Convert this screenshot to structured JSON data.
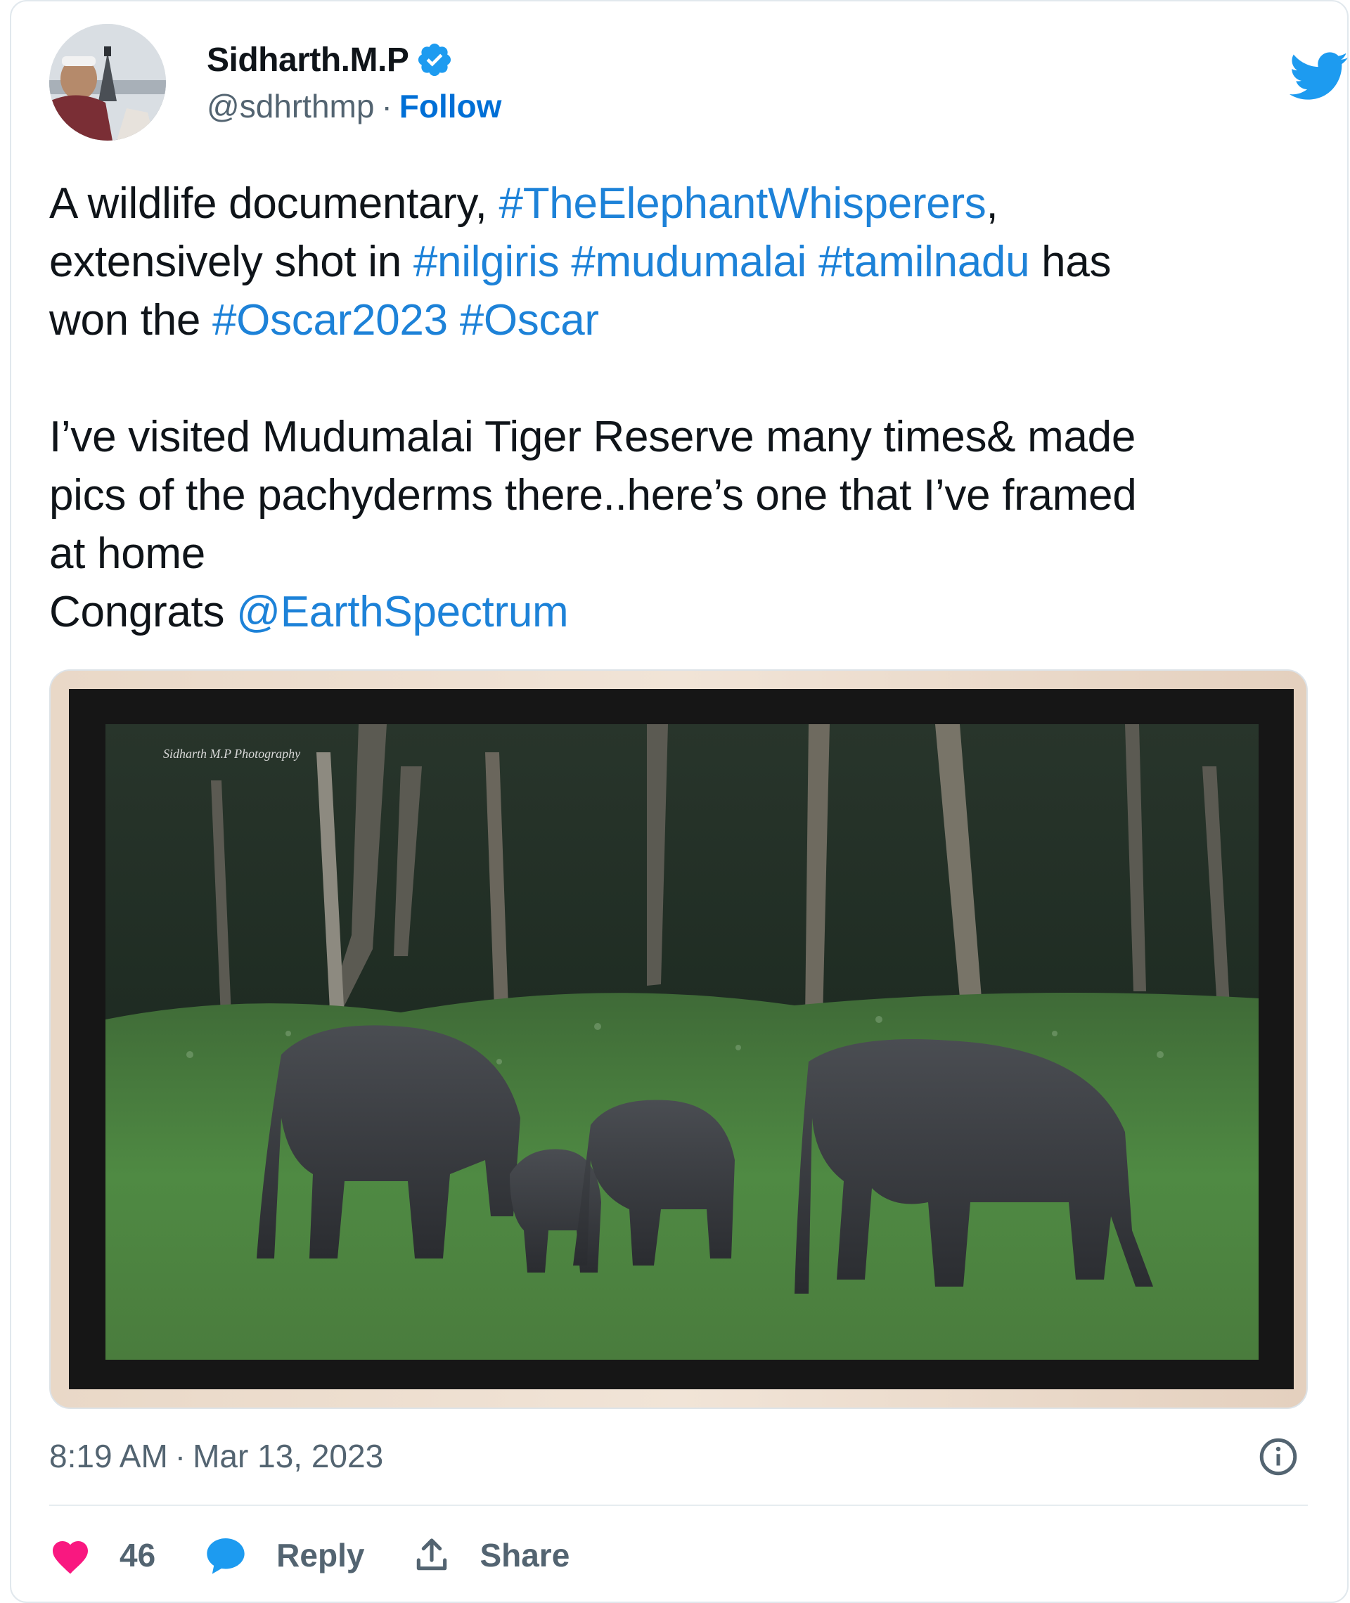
{
  "author": {
    "display_name": "Sidharth.M.P",
    "handle": "@sdhrthmp",
    "separator": "·",
    "follow_label": "Follow"
  },
  "tweet": {
    "line1_prefix": "A wildlife documentary, ",
    "tag_elephant": "#TheElephantWhisperers",
    "line1_suffix": ",",
    "line2_prefix": "extensively shot in ",
    "tag_nilgiris": "#nilgiris",
    "tag_mudumalai": "#mudumalai",
    "tag_tamilnadu": "#tamilnadu",
    "line2_suffix": " has",
    "line3_prefix": "won the ",
    "tag_oscar2023": "#Oscar2023",
    "tag_oscar": "#Oscar",
    "para2_line1": "I’ve visited Mudumalai Tiger Reserve many times& made",
    "para2_line2": "pics of the pachyderms there..here’s one that I’ve framed",
    "para2_line3": "at home",
    "congrats_prefix": "Congrats ",
    "mention": "@EarthSpectrum"
  },
  "media": {
    "watermark": "Sidharth M.P Photography"
  },
  "meta": {
    "time": "8:19 AM",
    "separator": "·",
    "date": "Mar 13, 2023"
  },
  "actions": {
    "like_count": "46",
    "reply_label": "Reply",
    "share_label": "Share"
  },
  "colors": {
    "link": "#1d82d8",
    "follow": "#006fd6",
    "like": "#f91880",
    "reply": "#1d9bf0",
    "twitter_blue": "#1d9bf0",
    "verified": "#1d9bf0"
  },
  "icons": {
    "verified": "verified-badge-icon",
    "brand": "twitter-bird-icon",
    "info": "info-icon",
    "like": "heart-icon",
    "reply": "speech-bubble-icon",
    "share": "share-upload-icon"
  }
}
